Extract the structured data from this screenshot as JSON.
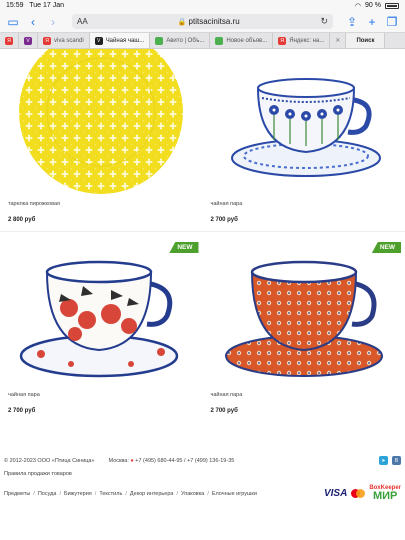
{
  "status": {
    "time": "15:59",
    "date": "Tue 17 Jan",
    "battery": "90 %"
  },
  "toolbar": {
    "aa": "AA",
    "url": "ptitsacinitsa.ru"
  },
  "tabs": [
    {
      "label": "",
      "favicon_color": "#e53935",
      "favicon_text": "Я"
    },
    {
      "label": "",
      "favicon_color": "#7a2a8e",
      "favicon_text": "V"
    },
    {
      "label": "viva scandi",
      "favicon_color": "#e53935",
      "favicon_text": "Я"
    },
    {
      "label": "Чайная чаш...",
      "favicon_color": "#222222",
      "favicon_text": "V",
      "active": true
    },
    {
      "label": "Авито | Объ...",
      "favicon_color": "#4caf50",
      "favicon_text": ""
    },
    {
      "label": "Новое объяв...",
      "favicon_color": "#4caf50",
      "favicon_text": ""
    },
    {
      "label": "Яндекс: на...",
      "favicon_color": "#e53935",
      "favicon_text": "Я"
    }
  ],
  "tabs_search": "Поиск",
  "products": [
    {
      "name": "тарелка пирожковая",
      "price": "2 800 руб",
      "image": "yellow-flower-plate",
      "badge": ""
    },
    {
      "name": "чайная пара",
      "price": "2 700 руб",
      "image": "blue-flower-cup",
      "badge": ""
    },
    {
      "name": "чайная пара",
      "price": "2 700 руб",
      "image": "red-berry-cup",
      "badge": "NEW"
    },
    {
      "name": "чайная пара",
      "price": "2 700 руб",
      "image": "orange-floral-cup",
      "badge": "NEW"
    }
  ],
  "footer": {
    "copyright": "© 2012-2023 ООО «Птица Синица»",
    "city": "Москва:",
    "phones": "+7 (495) 680-44-95 / +7 (499) 136-19-35",
    "rules": "Правила продажи товаров",
    "links": [
      "Предметы",
      "Посуда",
      "Бижутерия",
      "Текстиль",
      "Декор интерьера",
      "Упаковка",
      "Елочные игрушки"
    ],
    "link_sep": "/",
    "pay": {
      "visa": "VISA",
      "mastercard": "MasterCard",
      "bk1": "BoxKeeper",
      "bk2": "МИР"
    }
  },
  "colors": {
    "accent": "#1a73e8",
    "badge": "#4ea02c"
  }
}
